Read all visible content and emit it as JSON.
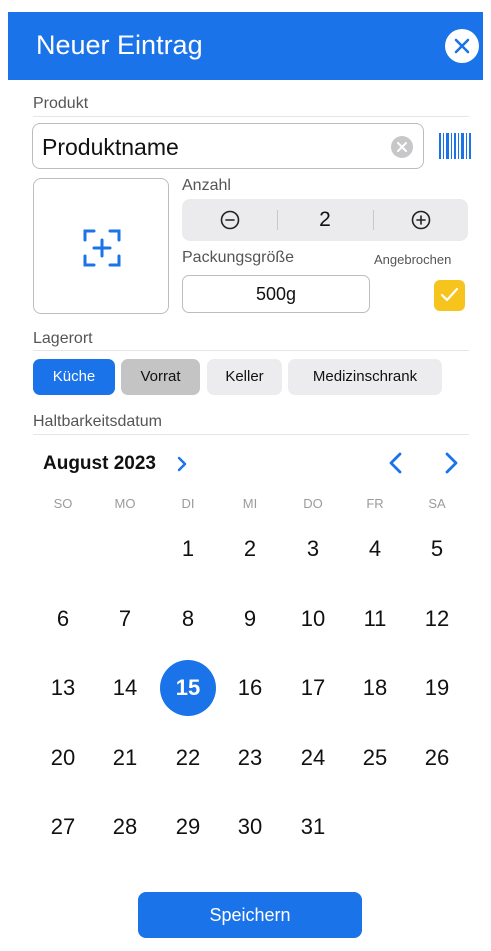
{
  "header": {
    "title": "Neuer Eintrag",
    "close_icon": "close-circle-icon",
    "accent": "#1a73e8"
  },
  "product": {
    "section_label": "Produkt",
    "value": "Produktname",
    "clear_icon": "clear-icon",
    "barcode_icon": "barcode-icon"
  },
  "photo": {
    "icon": "add-photo-icon"
  },
  "quantity": {
    "label": "Anzahl",
    "value": "2",
    "minus_icon": "minus-circle-icon",
    "plus_icon": "plus-circle-icon"
  },
  "package": {
    "label": "Packungsgröße",
    "value": "500g",
    "opened_label": "Angebrochen",
    "opened_checked": true,
    "checkbox_color": "#f6c41d"
  },
  "location": {
    "label": "Lagerort",
    "options": [
      "Küche",
      "Vorrat",
      "Keller",
      "Medizinschrank"
    ],
    "selected": "Küche"
  },
  "expiry": {
    "label": "Haltbarkeitsdatum",
    "month": "August 2023",
    "weekdays": [
      "SO",
      "MO",
      "DI",
      "MI",
      "DO",
      "FR",
      "SA"
    ],
    "days": [
      "1",
      "2",
      "3",
      "4",
      "5",
      "6",
      "7",
      "8",
      "9",
      "10",
      "11",
      "12",
      "13",
      "14",
      "15",
      "16",
      "17",
      "18",
      "19",
      "20",
      "21",
      "22",
      "23",
      "24",
      "25",
      "26",
      "27",
      "28",
      "29",
      "30",
      "31"
    ],
    "selected_day": "15"
  },
  "footer": {
    "save_label": "Speichern"
  }
}
